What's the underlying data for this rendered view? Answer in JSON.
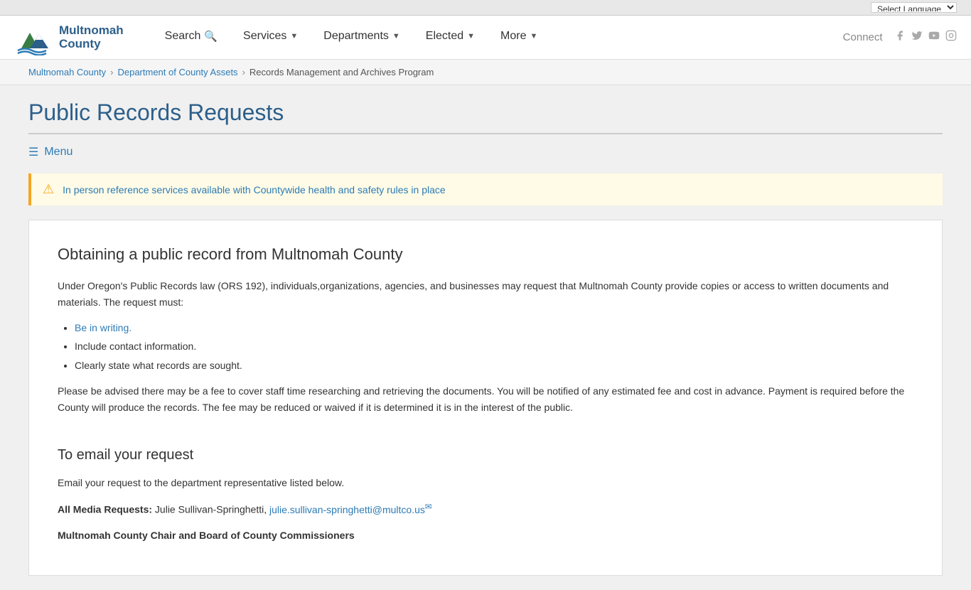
{
  "langBar": {
    "selectLabel": "Select Language"
  },
  "header": {
    "logoName": "Multnomah",
    "logoCounty": "County",
    "nav": [
      {
        "label": "Search",
        "hasIcon": true,
        "hasArrow": false,
        "name": "search-nav"
      },
      {
        "label": "Services",
        "hasArrow": true,
        "name": "services-nav"
      },
      {
        "label": "Departments",
        "hasArrow": true,
        "name": "departments-nav"
      },
      {
        "label": "Elected",
        "hasArrow": true,
        "name": "elected-nav"
      },
      {
        "label": "More",
        "hasArrow": true,
        "name": "more-nav"
      }
    ],
    "connect": "Connect"
  },
  "breadcrumb": [
    {
      "label": "Multnomah County",
      "href": "#"
    },
    {
      "label": "Department of County Assets",
      "href": "#"
    },
    {
      "label": "Records Management and Archives Program",
      "href": "#"
    }
  ],
  "pageTitle": "Public Records Requests",
  "menuToggle": "Menu",
  "alert": {
    "text": "In person reference services available with Countywide health and safety rules in place"
  },
  "content": {
    "section1Title": "Obtaining a public record from Multnomah County",
    "section1Para1": "Under Oregon's Public Records law (ORS 192), individuals,organizations, agencies, and businesses may request that Multnomah County provide copies or access to written documents and materials. The request must:",
    "bulletItems": [
      "Be in writing.",
      "Include contact information.",
      "Clearly state what records are sought."
    ],
    "section1Para2": "Please be advised there may be a fee to cover staff time researching and retrieving the documents. You will be notified of any estimated fee and cost in advance. Payment is required before the County will produce the records. The fee may be reduced or waived if it is determined it is in the interest of the public.",
    "section2Title": "To email your request",
    "section2Para1": "Email your request to the department representative listed below.",
    "mediaLabel": "All Media Requests:",
    "mediaContact": "Julie Sullivan-Springhetti, ",
    "mediaEmail": "julie.sullivan-springhetti@multco.us",
    "section3Label": "Multnomah County Chair and Board of County Commissioners"
  }
}
